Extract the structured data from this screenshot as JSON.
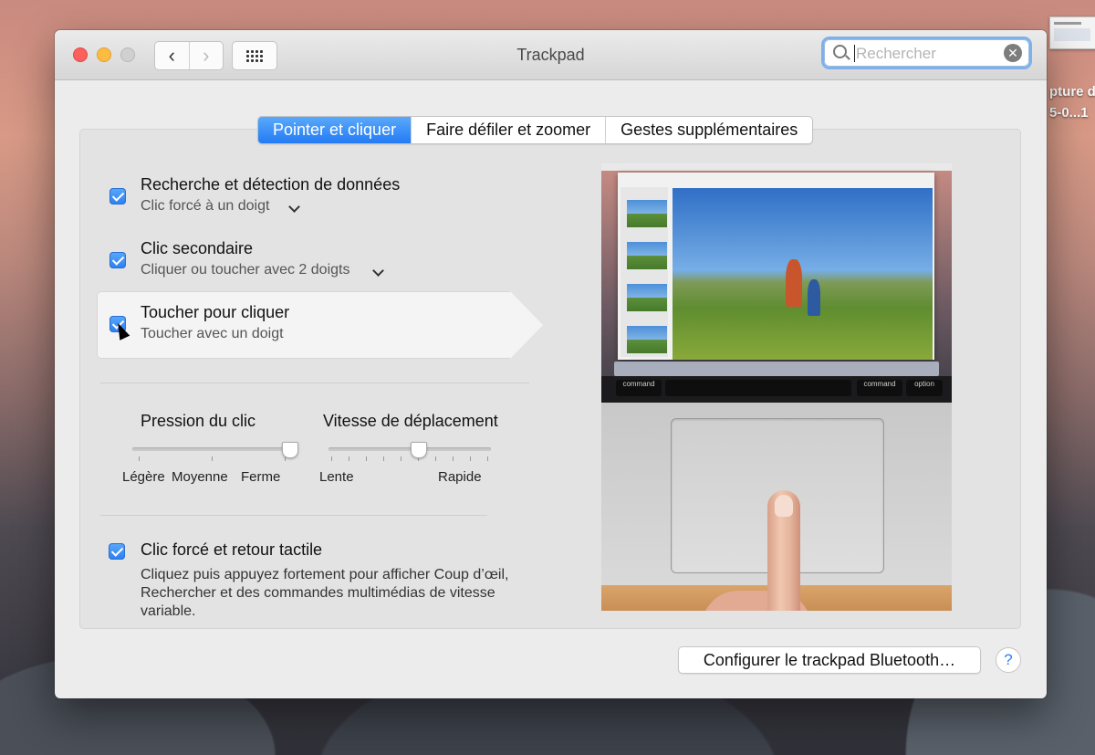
{
  "desktop": {
    "labels": [
      "pture d",
      "5-0...1"
    ]
  },
  "window": {
    "title": "Trackpad",
    "nav": {
      "back_icon": "‹",
      "forward_icon": "›"
    },
    "search": {
      "placeholder": "Rechercher",
      "value": ""
    }
  },
  "tabs": [
    "Pointer et cliquer",
    "Faire défiler et zoomer",
    "Gestes supplémentaires"
  ],
  "options": [
    {
      "title": "Recherche et détection de données",
      "subtitle": "Clic forcé à un doigt",
      "checked": true,
      "has_menu": true
    },
    {
      "title": "Clic secondaire",
      "subtitle": "Cliquer ou toucher avec 2 doigts",
      "checked": true,
      "has_menu": true
    },
    {
      "title": "Toucher pour cliquer",
      "subtitle": "Toucher avec un doigt",
      "checked": true,
      "has_menu": false
    }
  ],
  "sliders": {
    "pression": {
      "title": "Pression du clic",
      "labels": [
        "Légère",
        "Moyenne",
        "Ferme"
      ],
      "value_fraction": 1.0
    },
    "vitesse": {
      "title": "Vitesse de déplacement",
      "labels": [
        "Lente",
        "Rapide"
      ],
      "value_fraction": 0.55
    }
  },
  "force_click": {
    "title": "Clic forcé et retour tactile",
    "description": "Cliquez puis appuyez fortement pour afficher Coup d’œil, Rechercher et des commandes multimédias de vitesse variable.",
    "checked": true
  },
  "preview": {
    "keys": [
      "command",
      "command",
      "option"
    ]
  },
  "footer": {
    "bluetooth_button": "Configurer le trackpad Bluetooth…",
    "help_label": "?"
  },
  "colors": {
    "accent": "#2a7ff2",
    "window_bg": "#ececec"
  }
}
